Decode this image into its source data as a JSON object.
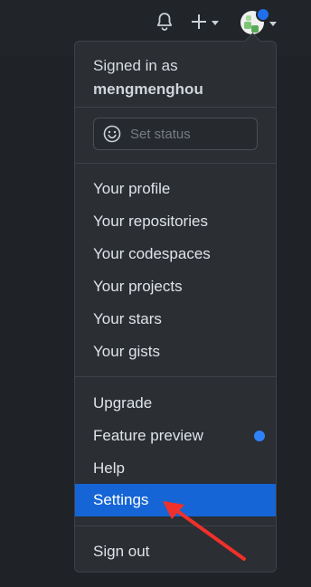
{
  "header": {
    "bell_icon": "bell-icon",
    "plus_icon": "plus-icon",
    "avatar_icon": "avatar-icon",
    "status_dot_color": "#1f6feb"
  },
  "menu": {
    "signed_in_label": "Signed in as",
    "username": "mengmenghou",
    "status_placeholder": "Set status",
    "profile_items": [
      {
        "label": "Your profile"
      },
      {
        "label": "Your repositories"
      },
      {
        "label": "Your codespaces"
      },
      {
        "label": "Your projects"
      },
      {
        "label": "Your stars"
      },
      {
        "label": "Your gists"
      }
    ],
    "misc_items": [
      {
        "label": "Upgrade"
      },
      {
        "label": "Feature preview"
      },
      {
        "label": "Help"
      },
      {
        "label": "Settings"
      }
    ],
    "sign_out": "Sign out",
    "active_color": "#1565d6",
    "annotation_color": "#f0302a"
  }
}
